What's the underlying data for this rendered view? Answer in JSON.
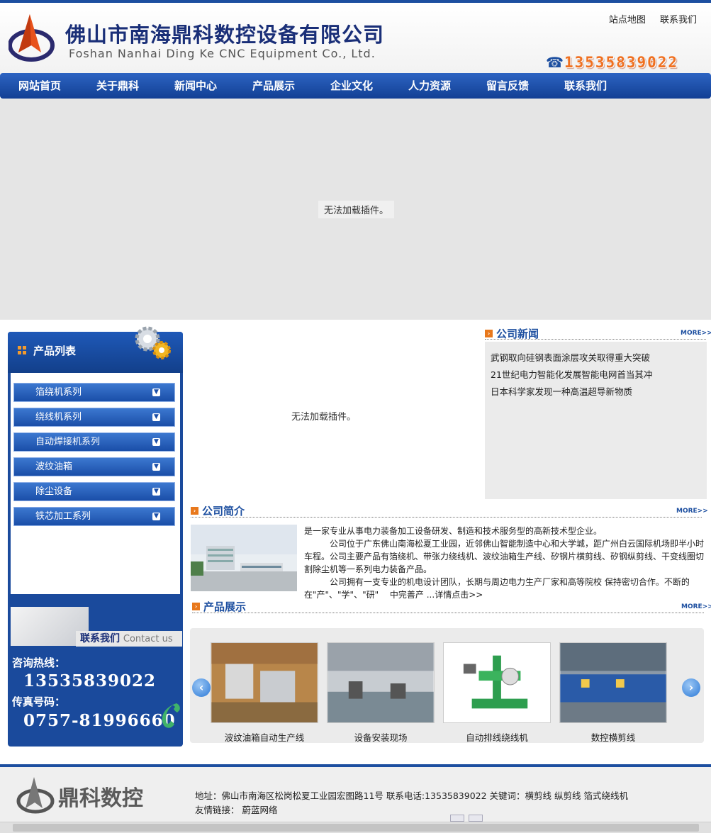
{
  "header": {
    "company_cn": "佛山市南海鼎科数控设备有限公司",
    "company_en": "Foshan Nanhai Ding Ke CNC Equipment Co., Ltd.",
    "top_links": [
      "站点地图",
      "联系我们"
    ],
    "phone_icon": "telephone-icon",
    "phone": "13535839022"
  },
  "nav": {
    "items": [
      "网站首页",
      "关于鼎科",
      "新闻中心",
      "产品展示",
      "企业文化",
      "人力资源",
      "留言反馈",
      "联系我们"
    ]
  },
  "banner": {
    "plugin_message": "无法加载插件。"
  },
  "sidebar": {
    "title": "产品列表",
    "items": [
      "箔绕机系列",
      "绕线机系列",
      "自动焊接机系列",
      "波纹油箱",
      "除尘设备",
      "铁芯加工系列"
    ],
    "contact_label": "联系我们",
    "contact_label_en": "Contact us",
    "hotline_label": "咨询热线：",
    "hotline": "13535839022",
    "fax_label": "传真号码：",
    "fax": "0757-81996660"
  },
  "center_flash": {
    "plugin_message": "无法加载插件。"
  },
  "news": {
    "title": "公司新闻",
    "more": "MORE>>",
    "items": [
      "武钢取向硅钢表面涂层攻关取得重大突破",
      "21世纪电力智能化发展智能电网首当其冲",
      "日本科学家发现一种高温超导新物质"
    ]
  },
  "intro": {
    "title": "公司简介",
    "more": "MORE>>",
    "line1": "是一家专业从事电力装备加工设备研发、制造和技术服务型的高新技术型企业。",
    "line2": "　　　公司位于广东佛山南海松夏工业园，近邻佛山智能制造中心和大学城，距广州白云国际机场即半小时车程。公司主要产品有箔绕机、带张力绕线机、波纹油箱生产线、矽钢片横剪线、矽钢纵剪线、干变线圈切割除尘机等一系列电力装备产品。",
    "line3": "　　　公司拥有一支专业的机电设计团队，长期与周边电力生产厂家和高等院校 保持密切合作。不断的在\"产\"、\"学\"、\"研\"　 中完善产 ...详情点击>>"
  },
  "products": {
    "title": "产品展示",
    "more": "MORE>>",
    "items": [
      "波纹油箱自动生产线",
      "设备安装现场",
      "自动排线绕线机",
      "数控横剪线"
    ]
  },
  "footer": {
    "logo_text": "鼎科数控",
    "address_line": "地址：佛山市南海区松岗松夏工业园宏图路11号  联系电话:13535839022  关键词：横剪线  纵剪线  箔式绕线机",
    "links_label": "友情链接：",
    "link1": "蔚蓝网络"
  },
  "colors": {
    "brand_blue": "#1d4fa0",
    "accent_orange": "#e8781c"
  }
}
